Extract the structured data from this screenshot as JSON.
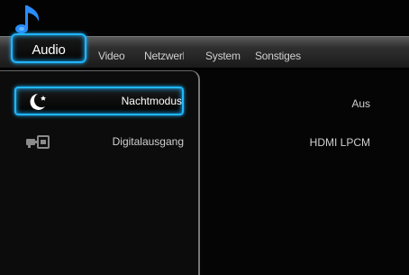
{
  "tabs": [
    {
      "label": "Audio"
    },
    {
      "label": "Video"
    },
    {
      "label": "Netzwerk"
    },
    {
      "label": "System"
    },
    {
      "label": "Sonstiges"
    }
  ],
  "menu": [
    {
      "label": "Nachtmodus",
      "value": "Aus",
      "icon": "night-mode-icon"
    },
    {
      "label": "Digitalausgang",
      "value": "HDMI LPCM",
      "icon": "digital-output-icon"
    }
  ],
  "colors": {
    "highlight": "#1fb6ff",
    "accent_icon": "#1a8cff"
  }
}
